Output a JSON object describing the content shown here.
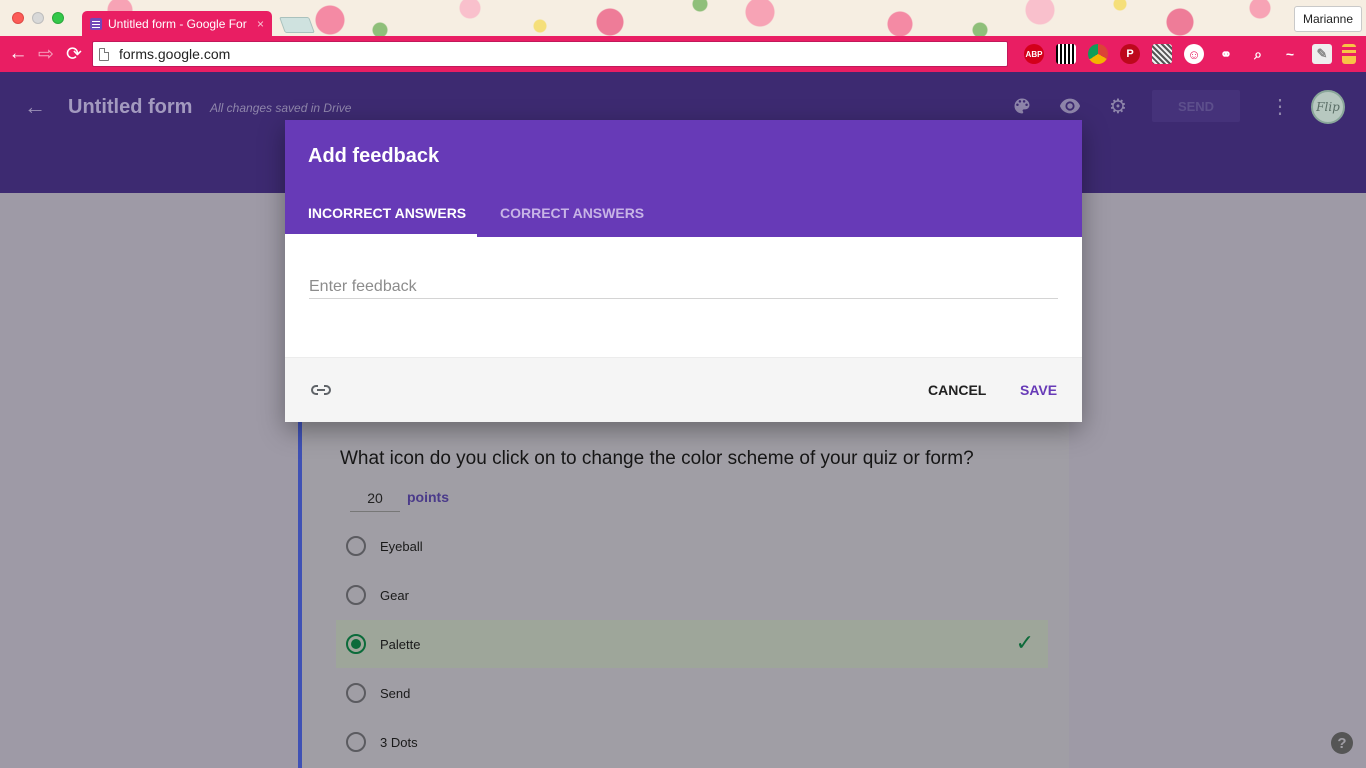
{
  "browser": {
    "tab_title": "Untitled form - Google For",
    "tab_close": "×",
    "profile_name": "Marianne",
    "url": "forms.google.com",
    "nav": {
      "back": "←",
      "forward": "⇨",
      "reload": "⟳"
    },
    "extensions": [
      "ABP",
      "",
      "",
      "P",
      "",
      "☺",
      "⚭",
      "⌕",
      "~",
      "✎",
      ""
    ]
  },
  "header": {
    "back_glyph": "←",
    "title": "Untitled form",
    "saved_note": "All changes saved in Drive",
    "palette_glyph": "🎨",
    "eye_glyph": "◉",
    "gear_glyph": "⚙",
    "send_label": "SEND",
    "more_glyph": "⋮",
    "avatar_text": "Flip"
  },
  "question": {
    "text": "What icon do you click on to change the color scheme of your quiz or form?",
    "points_value": "20",
    "points_label": "points",
    "options": [
      {
        "label": "Eyeball",
        "checked": false
      },
      {
        "label": "Gear",
        "checked": false
      },
      {
        "label": "Palette",
        "checked": true,
        "correct_mark": "✓"
      },
      {
        "label": "Send",
        "checked": false
      },
      {
        "label": "3 Dots",
        "checked": false
      }
    ]
  },
  "dialog": {
    "title": "Add feedback",
    "tabs": [
      "INCORRECT ANSWERS",
      "CORRECT ANSWERS"
    ],
    "active_tab": "INCORRECT ANSWERS",
    "feedback_placeholder": "Enter feedback",
    "feedback_value": "",
    "cancel_label": "CANCEL",
    "save_label": "SAVE"
  },
  "help_glyph": "?",
  "colors": {
    "accent": "#673ab7",
    "chrome_pink": "#e91e63",
    "header_dim": "#3d2a71",
    "correct_green": "#0b6b3a"
  }
}
